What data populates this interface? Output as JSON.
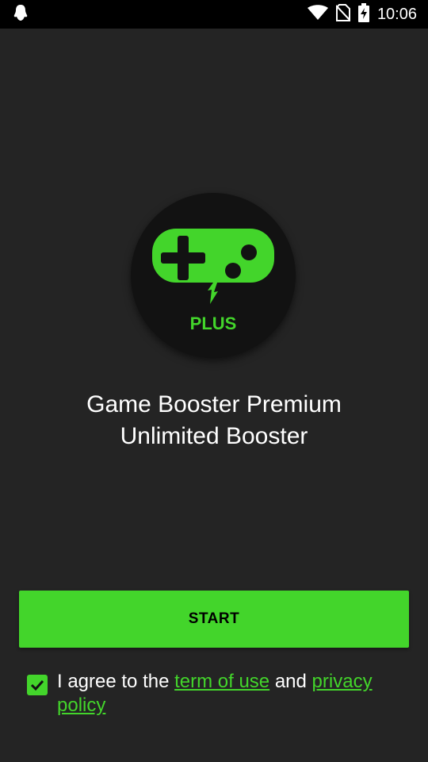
{
  "status_bar": {
    "time": "10:06",
    "icons": [
      "notification-icon",
      "wifi-icon",
      "no-sim-icon",
      "battery-charging-icon"
    ]
  },
  "logo": {
    "badge_text": "PLUS",
    "accent_color": "#43d52b",
    "icon": "gamepad-icon"
  },
  "app_title": {
    "line1": "Game Booster Premium",
    "line2": "Unlimited Booster"
  },
  "start_button": {
    "label": "START"
  },
  "agreement": {
    "checked": true,
    "prefix": "I agree to the ",
    "term_link": "term of use",
    "middle": " and ",
    "privacy_link": "privacy policy"
  },
  "colors": {
    "background": "#242424",
    "accent": "#43d52b",
    "status_bar": "#000000"
  }
}
